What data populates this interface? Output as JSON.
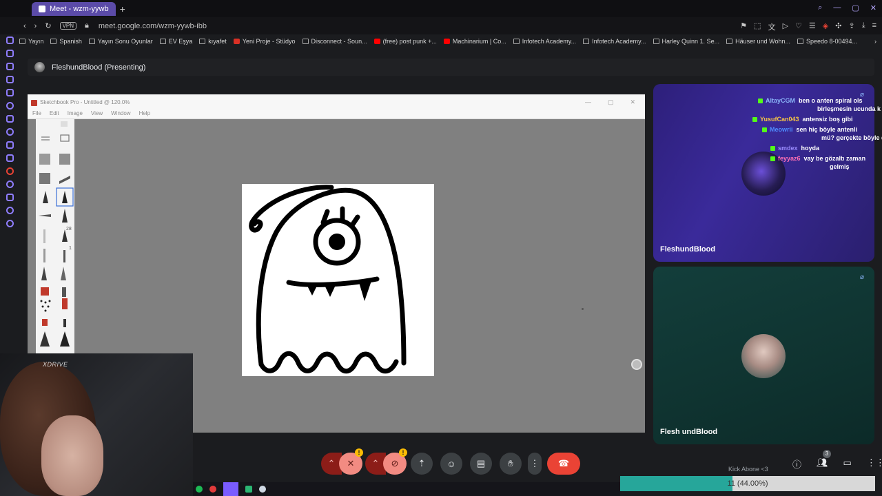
{
  "browser": {
    "tab_title": "Meet - wzm-yywb",
    "url": "meet.google.com/wzm-yywb-ibb",
    "vpn_label": "VPN"
  },
  "bookmarks": [
    {
      "label": "Yayın",
      "icon": "folder-icon"
    },
    {
      "label": "Spanish",
      "icon": "folder-icon"
    },
    {
      "label": "Yayın Sonu Oyunlar",
      "icon": "folder-icon"
    },
    {
      "label": "EV Eşya",
      "icon": "folder-icon"
    },
    {
      "label": "kıyafet",
      "icon": "folder-icon"
    },
    {
      "label": "Yeni Proje - Stüdyo",
      "icon": "red-site-icon"
    },
    {
      "label": "Disconnect - Soun...",
      "icon": "link-icon"
    },
    {
      "label": "(free) post punk +...",
      "icon": "youtube-icon"
    },
    {
      "label": "Machinarium | Co...",
      "icon": "youtube-icon"
    },
    {
      "label": "Infotech Academy...",
      "icon": "site-icon"
    },
    {
      "label": "Infotech Academy...",
      "icon": "site-icon"
    },
    {
      "label": "Harley Quinn 1. Se...",
      "icon": "site-icon"
    },
    {
      "label": "Häuser und Wohn...",
      "icon": "site-icon"
    },
    {
      "label": "Speedo 8-00494...",
      "icon": "site-icon"
    }
  ],
  "meet": {
    "presenter_label": "FleshundBlood (Presenting)"
  },
  "sketchbook": {
    "window_title": "Sketchbook Pro - Untitled @ 120.0%",
    "menu": [
      "File",
      "Edit",
      "Image",
      "View",
      "Window",
      "Help"
    ],
    "brush_size_a": "28",
    "brush_size_b": "1"
  },
  "webcam": {
    "overlay_brand": "XDRIVE"
  },
  "participants": [
    {
      "name": "FleshundBlood"
    },
    {
      "name": "Flesh undBlood"
    }
  ],
  "chat": [
    {
      "user": "AltayCGM",
      "color": "#8ab4f8",
      "msg": "ben o anten spiral ols",
      "cont": "birleşmesin ucunda k"
    },
    {
      "user": "YusufCan043",
      "color": "#f6c445",
      "msg": "antensiz boş gibi",
      "cont": ""
    },
    {
      "user": "Meowrii",
      "color": "#4f8cff",
      "msg": "sen hiç böyle antenli",
      "cont": "mü? gerçekte böyle d"
    },
    {
      "user": "smdex",
      "color": "#9b8cff",
      "msg": "hoyda",
      "cont": ""
    },
    {
      "user": "feyyaz6",
      "color": "#ff6fb5",
      "msg": "vay be gözaltı zaman",
      "cont": "gelmiş"
    }
  ],
  "controls": {
    "participant_count": "3",
    "warn_mark": "!"
  },
  "stream_overlay": {
    "goal_text": "Kick Abone <3",
    "progress_label": "11 (44.00%)",
    "progress_fraction": 0.44
  },
  "colors": {
    "accent": "#8f7dff",
    "end_call": "#ea4335",
    "kick_green": "#53fc18",
    "progress_fill": "#26a69a"
  }
}
